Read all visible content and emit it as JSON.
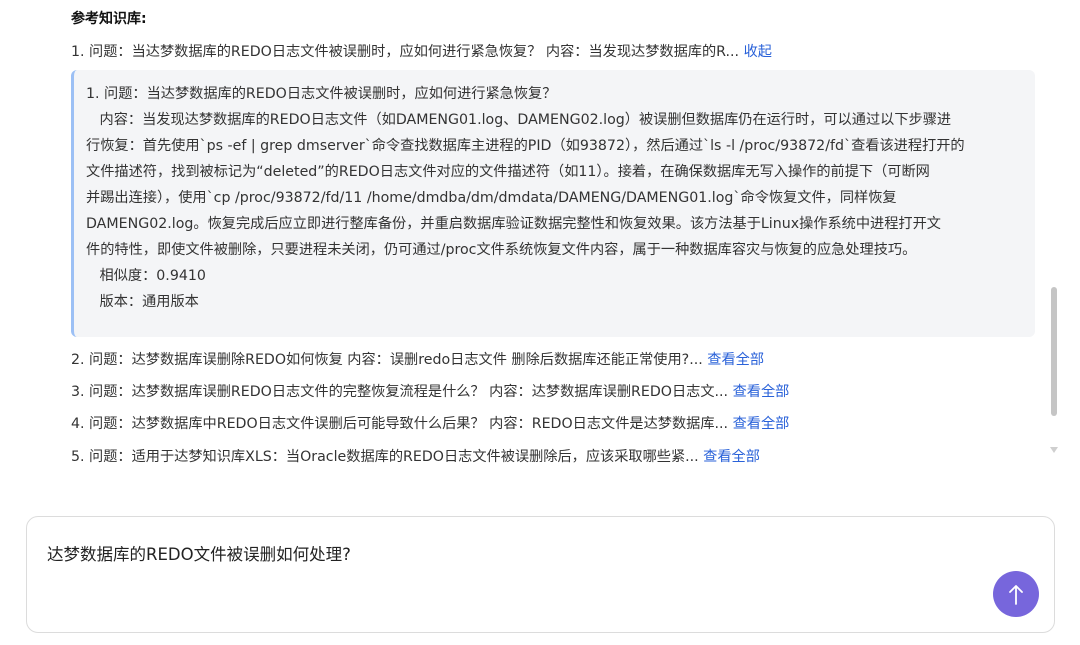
{
  "kb": {
    "title": "参考知识库:",
    "item1": {
      "summary": "1. 问题：当达梦数据库的REDO日志文件被误删时，应如何进行紧急恢复？ 内容：当发现达梦数据库的R...",
      "toggle": "收起",
      "detail_lines": [
        "1. 问题：当达梦数据库的REDO日志文件被误删时，应如何进行紧急恢复？",
        "   内容：当发现达梦数据库的REDO日志文件（如DAMENG01.log、DAMENG02.log）被误删但数据库仍在运行时，可以通过以下步骤进",
        "行恢复：首先使用`ps -ef | grep dmserver`命令查找数据库主进程的PID（如93872），然后通过`ls -l /proc/93872/fd`查看该进程打开的",
        "文件描述符，找到被标记为“deleted”的REDO日志文件对应的文件描述符（如11）。接着，在确保数据库无写入操作的前提下（可断网",
        "并踢出连接），使用`cp /proc/93872/fd/11 /home/dmdba/dm/dmdata/DAMENG/DAMENG01.log`命令恢复文件，同样恢复",
        "DAMENG02.log。恢复完成后应立即进行整库备份，并重启数据库验证数据完整性和恢复效果。该方法基于Linux操作系统中进程打开文",
        "件的特性，即使文件被删除，只要进程未关闭，仍可通过/proc文件系统恢复文件内容，属于一种数据库容灾与恢复的应急处理技巧。"
      ],
      "similarity": "   相似度：0.9410",
      "version": "   版本：通用版本"
    },
    "items": [
      {
        "text": "2. 问题：达梦数据库误删除REDO如何恢复 内容：误删redo日志文件 删除后数据库还能正常使用?... ",
        "link": "查看全部"
      },
      {
        "text": "3. 问题：达梦数据库误删REDO日志文件的完整恢复流程是什么？ 内容：达梦数据库误删REDO日志文... ",
        "link": "查看全部"
      },
      {
        "text": "4. 问题：达梦数据库中REDO日志文件误删后可能导致什么后果？ 内容：REDO日志文件是达梦数据库... ",
        "link": "查看全部"
      },
      {
        "text": "5. 问题：适用于达梦知识库XLS：当Oracle数据库的REDO日志文件被误删除后，应该采取哪些紧... ",
        "link": "查看全部"
      }
    ]
  },
  "input": {
    "value": "达梦数据库的REDO文件被误删如何处理?",
    "send_icon": "arrow-up-icon",
    "accent": "#7766dc"
  },
  "colors": {
    "link": "#2a62d9",
    "quote_border": "#9cc0f5",
    "quote_bg": "#f4f5f7"
  }
}
